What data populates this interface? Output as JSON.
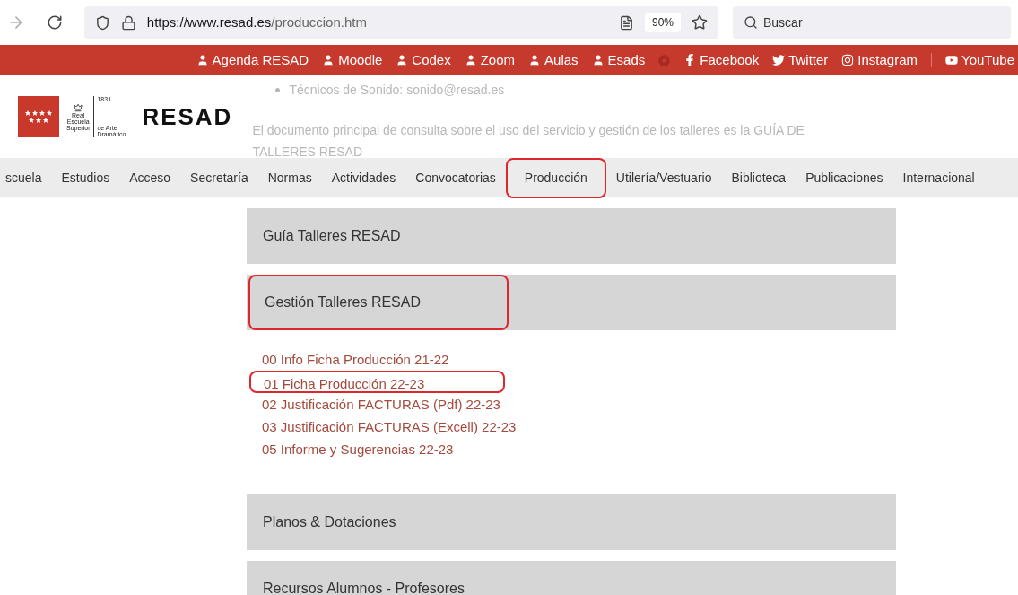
{
  "browser": {
    "url_host": "https://www.resad.es",
    "url_path": "/produccion.htm",
    "zoom": "90%",
    "search": {
      "placeholder": "Buscar"
    }
  },
  "top_links": [
    {
      "kind": "user",
      "label": "Agenda RESAD"
    },
    {
      "kind": "user",
      "label": "Moodle"
    },
    {
      "kind": "user",
      "label": "Codex"
    },
    {
      "kind": "user",
      "label": "Zoom"
    },
    {
      "kind": "user",
      "label": "Aulas"
    },
    {
      "kind": "user",
      "label": "Esads"
    },
    {
      "kind": "target"
    },
    {
      "kind": "facebook",
      "label": "Facebook"
    },
    {
      "kind": "twitter",
      "label": "Twitter"
    },
    {
      "kind": "instagram",
      "label": "Instagram"
    },
    {
      "kind": "youtube",
      "label": "YouTube"
    }
  ],
  "logo": {
    "line_1": "Real",
    "line_2": "Escuela",
    "line_3": "Superior",
    "year": "1831",
    "line_4": "de Arte",
    "line_5": "Dramático",
    "name": "RESAD"
  },
  "faded_text": {
    "bullet": "Técnicos de Sonido: sonido@resad.es",
    "paragraph": "El documento principal de consulta sobre el uso del servicio y gestión de los talleres es la GUÍA DE TALLERES RESAD"
  },
  "nav": [
    {
      "label": "scuela",
      "highlighted": false
    },
    {
      "label": "Estudios",
      "highlighted": false
    },
    {
      "label": "Acceso",
      "highlighted": false
    },
    {
      "label": "Secretaría",
      "highlighted": false
    },
    {
      "label": "Normas",
      "highlighted": false
    },
    {
      "label": "Actividades",
      "highlighted": false
    },
    {
      "label": "Convocatorias",
      "highlighted": false
    },
    {
      "label": "Producción",
      "highlighted": true
    },
    {
      "label": "Utilería/Vestuario",
      "highlighted": false
    },
    {
      "label": "Biblioteca",
      "highlighted": false
    },
    {
      "label": "Publicaciones",
      "highlighted": false
    },
    {
      "label": "Internacional",
      "highlighted": false
    }
  ],
  "sections": [
    {
      "title": "Guía Talleres RESAD",
      "highlighted": false
    },
    {
      "title": "Gestión Talleres RESAD",
      "highlighted": true,
      "links": [
        {
          "label": "00 Info Ficha Producción 21-22",
          "highlighted": false
        },
        {
          "label": "01 Ficha Producción 22-23",
          "highlighted": true
        },
        {
          "label": "02 Justificación FACTURAS (Pdf) 22-23",
          "highlighted": false
        },
        {
          "label": "03 Justificación FACTURAS (Excell) 22-23",
          "highlighted": false
        },
        {
          "label": "05 Informe y Sugerencias 22-23",
          "highlighted": false
        }
      ]
    },
    {
      "title": "Planos & Dotaciones",
      "highlighted": false
    },
    {
      "title": "Recursos Alumnos - Profesores",
      "highlighted": false
    }
  ]
}
